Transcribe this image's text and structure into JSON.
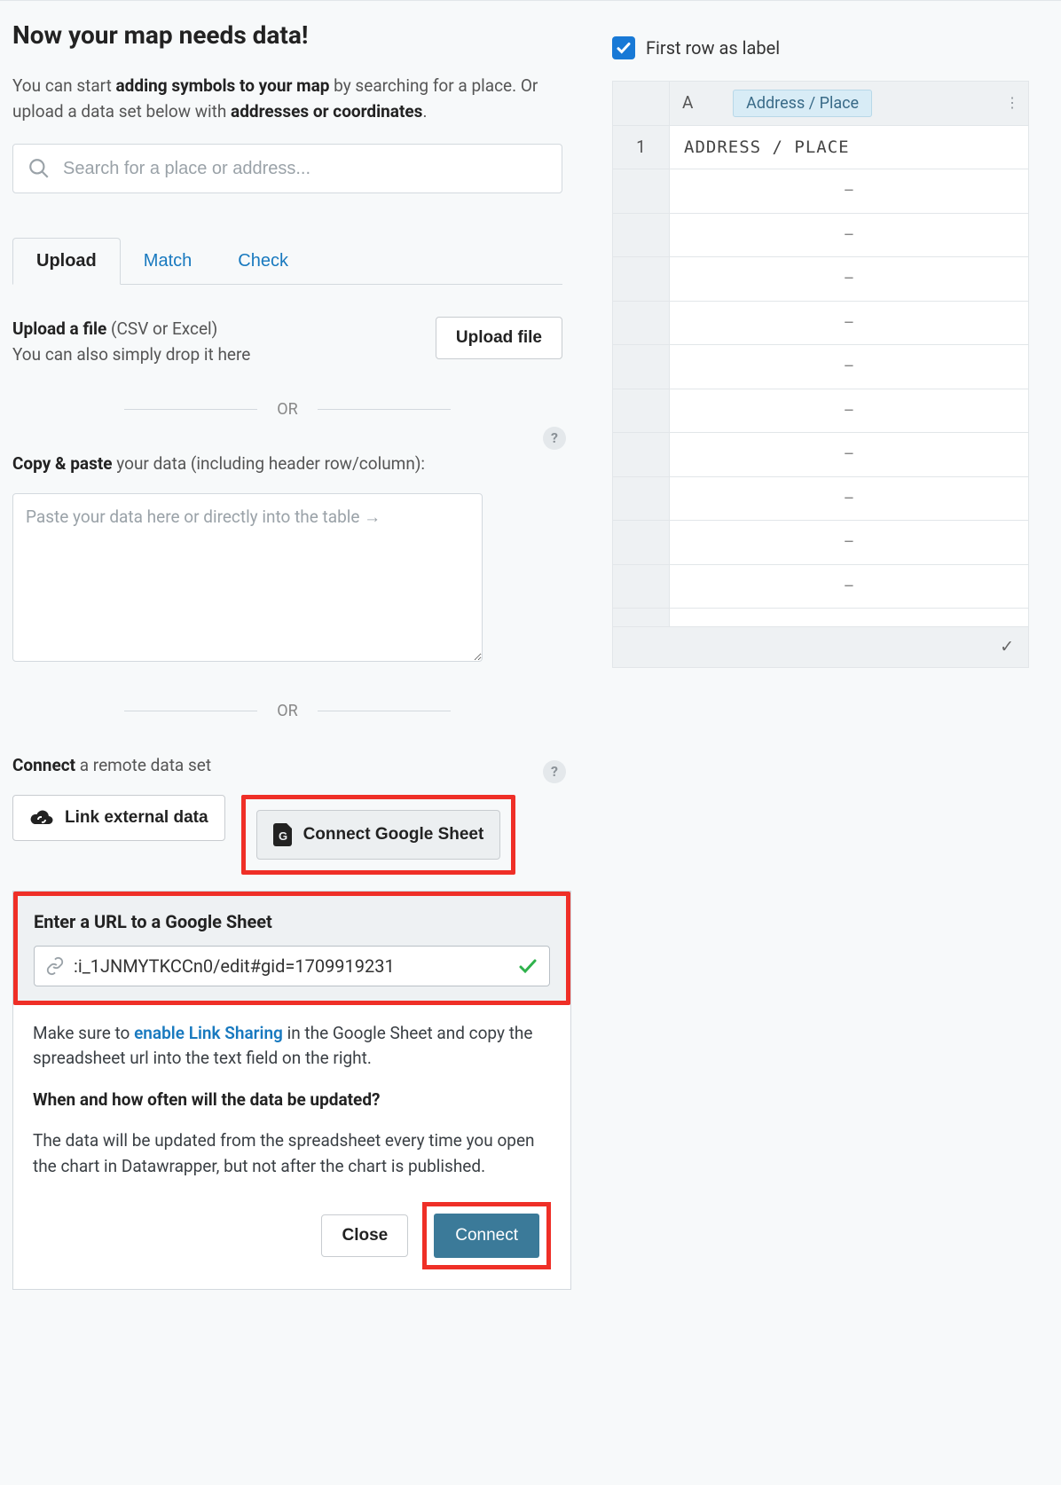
{
  "heading": "Now your map needs data!",
  "intro": {
    "pre": "You can start ",
    "bold1": "adding symbols to your map",
    "mid": " by searching for a place. Or upload a data set below with ",
    "bold2": "addresses or coordinates",
    "post": "."
  },
  "search": {
    "placeholder": "Search for a place or address..."
  },
  "tabs": {
    "upload": "Upload",
    "match": "Match",
    "check": "Check"
  },
  "upload": {
    "label": "Upload a file",
    "hint_suffix": " (CSV or Excel)",
    "sub": "You can also simply drop it here",
    "button": "Upload file"
  },
  "divider": "OR",
  "paste": {
    "label": "Copy & paste",
    "suffix": " your data (including header row/column):",
    "placeholder": "Paste your data here or directly into the table →"
  },
  "connect": {
    "label": "Connect",
    "suffix": " a remote data set",
    "link_external": "Link external data",
    "google_sheet": "Connect Google Sheet"
  },
  "modal": {
    "title": "Enter a URL to a Google Sheet",
    "url_value": ":i_1JNMYTKCCn0/edit#gid=1709919231",
    "help1_pre": "Make sure to ",
    "help1_link": "enable Link Sharing",
    "help1_post": " in the Google Sheet and copy the spreadsheet url into the text field on the right.",
    "question": "When and how often will the data be updated?",
    "answer": "The data will be updated from the spreadsheet every time you open the chart in Datawrapper, but not after the chart is published.",
    "close": "Close",
    "connect": "Connect"
  },
  "table": {
    "first_row_label": "First row as label",
    "col_letter": "A",
    "col_pill": "Address / Place",
    "row1": "1",
    "cell1": "ADDRESS / PLACE",
    "empty": "–",
    "footer_check": "✓"
  }
}
